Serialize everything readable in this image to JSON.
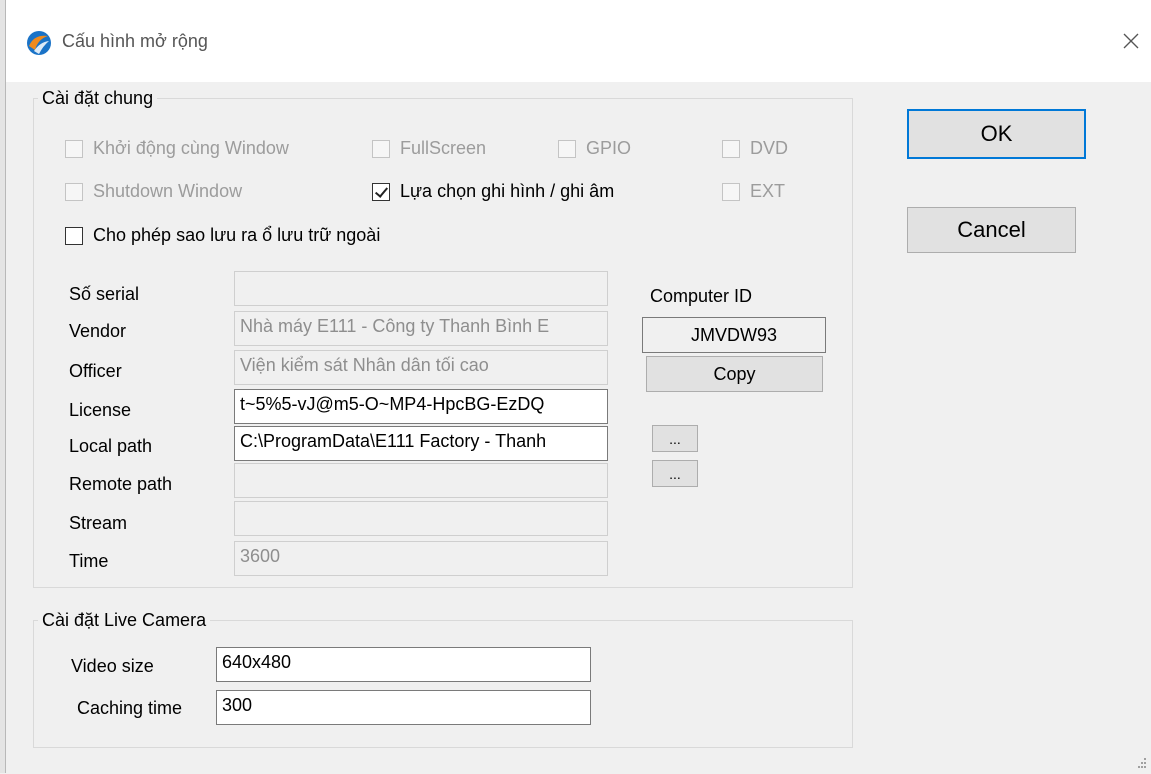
{
  "window": {
    "title": "Cấu hình mở rộng",
    "accent_color": "#0078d7",
    "icon": "app-logo-icon"
  },
  "general": {
    "legend": "Cài đặt chung",
    "checkboxes": [
      {
        "label": "Khởi động cùng Window",
        "checked": false,
        "enabled": false
      },
      {
        "label": "FullScreen",
        "checked": false,
        "enabled": false
      },
      {
        "label": "GPIO",
        "checked": false,
        "enabled": false
      },
      {
        "label": "DVD",
        "checked": false,
        "enabled": false
      },
      {
        "label": "Shutdown Window",
        "checked": false,
        "enabled": false
      },
      {
        "label": "Lựa chọn ghi hình / ghi âm",
        "checked": true,
        "enabled": true
      },
      {
        "label": "EXT",
        "checked": false,
        "enabled": false
      },
      {
        "label": "Cho phép sao lưu ra ổ lưu trữ ngoài",
        "checked": false,
        "enabled": true
      }
    ],
    "fields": [
      {
        "label": "Số serial",
        "value": "",
        "enabled": false
      },
      {
        "label": "Vendor",
        "value": "Nhà máy E111 - Công ty Thanh Bình E",
        "enabled": false
      },
      {
        "label": "Officer",
        "value": "Viện kiểm sát Nhân dân tối cao",
        "enabled": false
      },
      {
        "label": "License",
        "value": "t~5%5-vJ@m5-O~MP4-HpcBG-EzDQ",
        "enabled": true
      },
      {
        "label": "Local path",
        "value": "C:\\ProgramData\\E111 Factory - Thanh",
        "enabled": true
      },
      {
        "label": "Remote path",
        "value": "",
        "enabled": false
      },
      {
        "label": "Stream",
        "value": "",
        "enabled": false
      },
      {
        "label": "Time",
        "value": "3600",
        "enabled": false
      }
    ],
    "computer_id_label": "Computer ID",
    "computer_id_value": "JMVDW93",
    "copy_label": "Copy",
    "browse_local_label": "...",
    "browse_remote_label": "..."
  },
  "live_camera": {
    "legend": "Cài đặt Live Camera",
    "video_size_label": "Video size",
    "video_size_value": "640x480",
    "caching_time_label": "Caching time",
    "caching_time_value": "300"
  },
  "buttons": {
    "ok": "OK",
    "cancel": "Cancel"
  }
}
